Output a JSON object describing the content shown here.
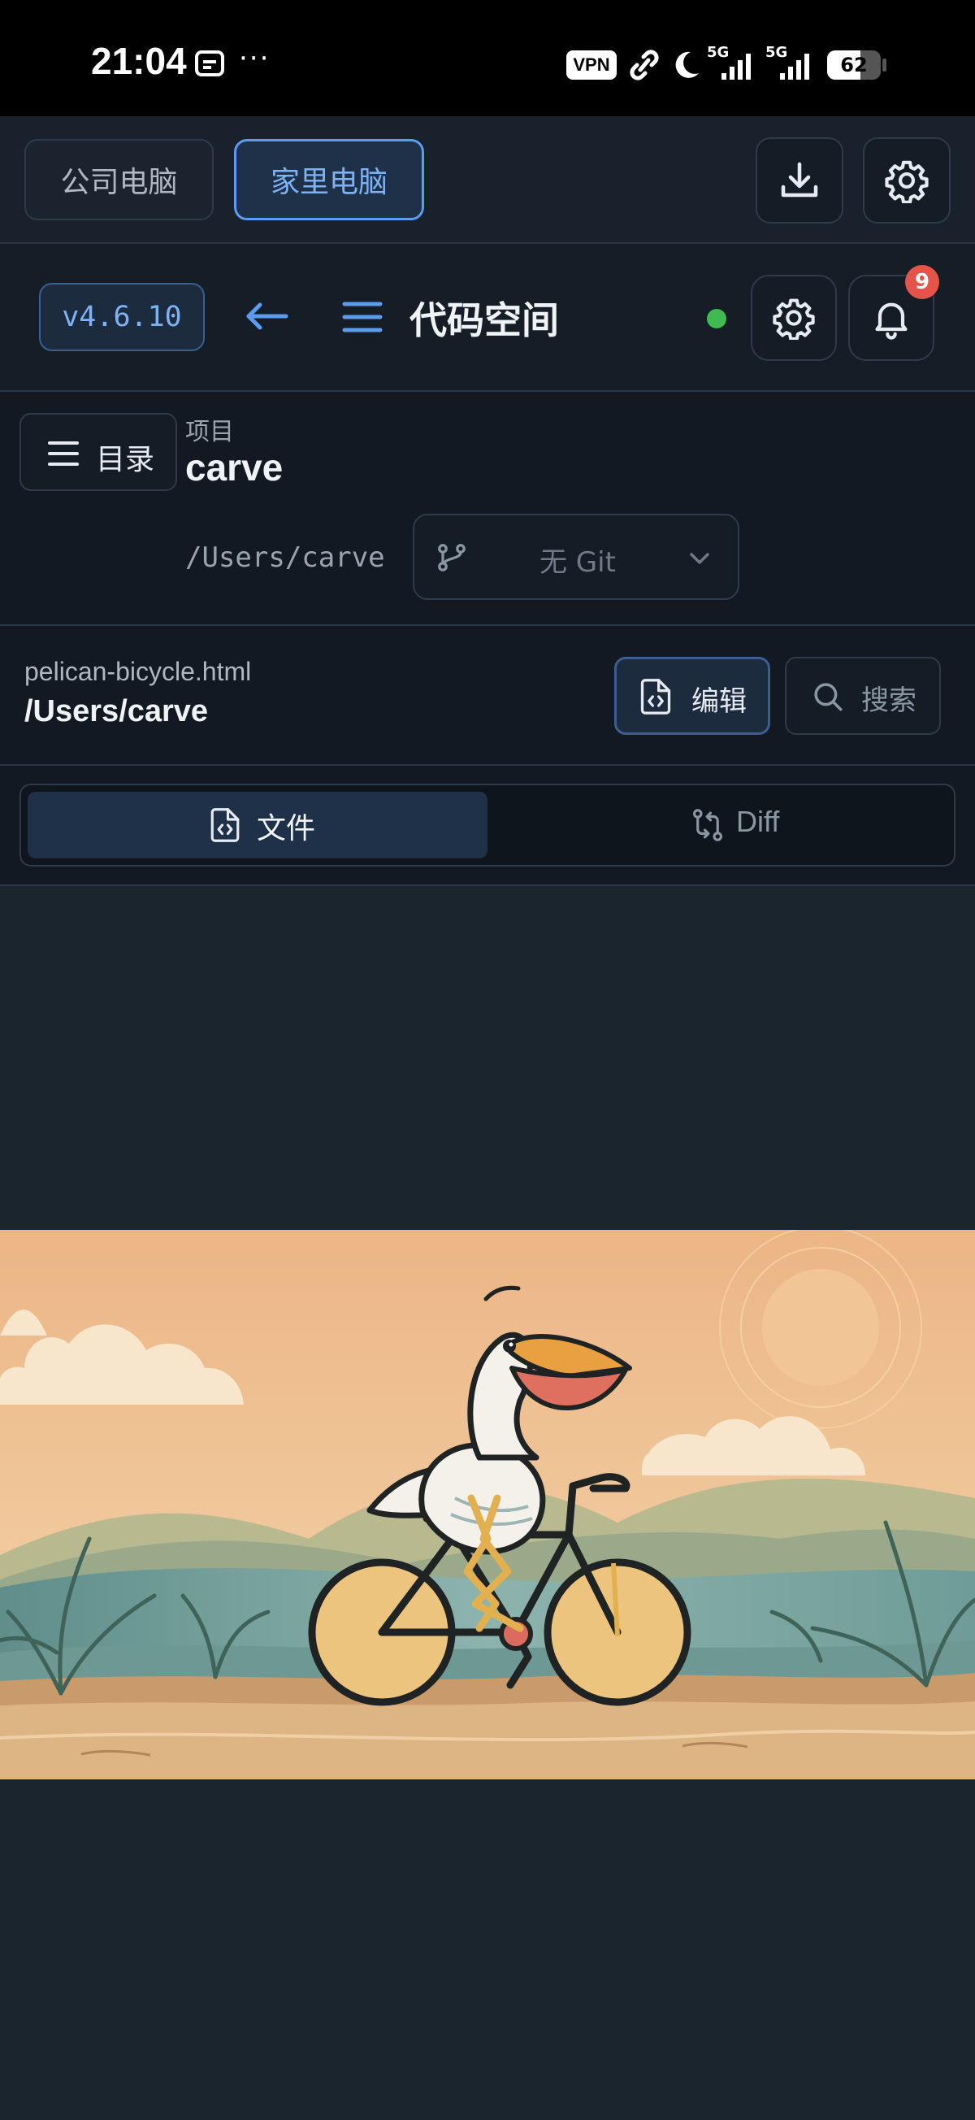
{
  "status_bar": {
    "time": "21:04",
    "more": "···",
    "vpn": "VPN",
    "net1": "5G",
    "net2": "5G",
    "battery": "62"
  },
  "top_bar": {
    "tabs": [
      {
        "label": "公司电脑",
        "active": false
      },
      {
        "label": "家里电脑",
        "active": true
      }
    ]
  },
  "header": {
    "version": "v4.6.10",
    "title": "代码空间",
    "notification_count": "9",
    "status_color": "#3fb950"
  },
  "project": {
    "menu_label": "目录",
    "section_label": "项目",
    "name": "carve",
    "path": "/Users/carve",
    "git_label": "无 Git"
  },
  "file": {
    "filename": "pelican-bicycle.html",
    "path": "/Users/carve",
    "edit_label": "编辑",
    "search_label": "搜索"
  },
  "view_tabs": [
    {
      "label": "文件",
      "active": true
    },
    {
      "label": "Diff",
      "active": false
    }
  ],
  "colors": {
    "accent": "#5b9cf0",
    "active_tab_bg": "#1e3148",
    "badge": "#e5534b"
  }
}
